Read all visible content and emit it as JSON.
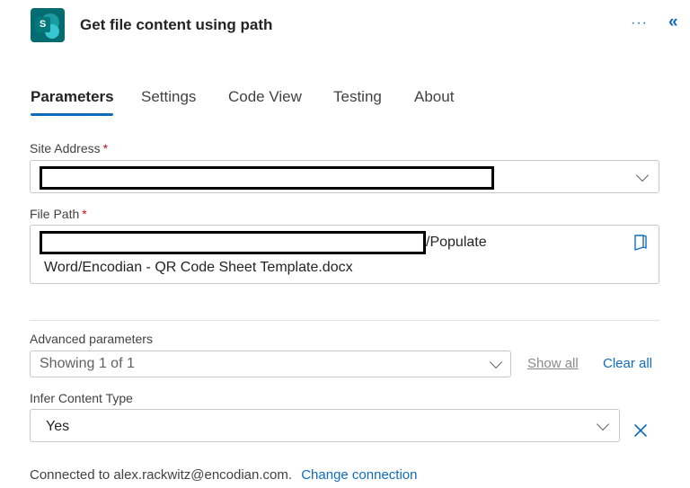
{
  "header": {
    "title": "Get file content using path",
    "app_icon_letter": "S",
    "more_label": "···",
    "collapse_label": "«"
  },
  "tabs": [
    {
      "label": "Parameters",
      "active": true
    },
    {
      "label": "Settings"
    },
    {
      "label": "Code View"
    },
    {
      "label": "Testing"
    },
    {
      "label": "About"
    }
  ],
  "site_address": {
    "label": "Site Address",
    "required_mark": "*"
  },
  "file_path": {
    "label": "File Path",
    "required_mark": "*",
    "value_line1_suffix": "/Populate",
    "value_line2": "Word/Encodian - QR Code Sheet Template.docx"
  },
  "advanced": {
    "label": "Advanced parameters",
    "value": "Showing 1 of 1",
    "show_all": "Show all",
    "clear_all": "Clear all"
  },
  "infer_content_type": {
    "label": "Infer Content Type",
    "value": "Yes"
  },
  "connection": {
    "text": "Connected to alex.rackwitz@encodian.com.",
    "change_label": "Change connection"
  },
  "colors": {
    "accent": "#0f6cbd",
    "required": "#c50f1f",
    "sharepoint": "#036c70"
  }
}
